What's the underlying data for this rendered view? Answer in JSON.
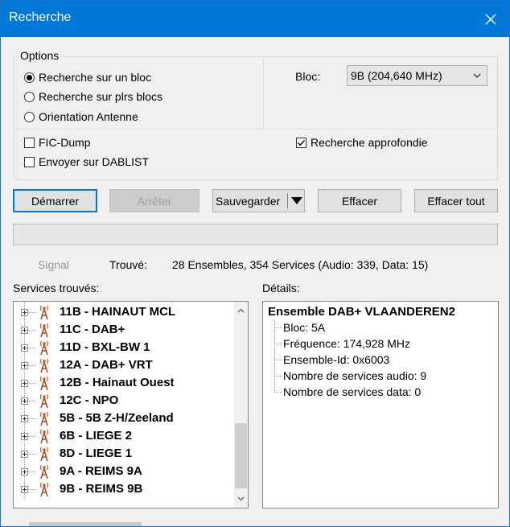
{
  "window": {
    "title": "Recherche"
  },
  "options": {
    "group_label": "Options",
    "search_modes": [
      {
        "label": "Recherche sur un bloc",
        "checked": true
      },
      {
        "label": "Recherche sur plrs blocs",
        "checked": false
      },
      {
        "label": "Orientation Antenne",
        "checked": false
      }
    ],
    "block_label": "Bloc:",
    "block_value": "9B (204,640 MHz)",
    "fic_dump": {
      "label": "FIC-Dump",
      "checked": false
    },
    "send_dablist": {
      "label": "Envoyer sur DABLIST",
      "checked": false
    },
    "deep_search": {
      "label": "Recherche approfondie",
      "checked": true
    }
  },
  "buttons": {
    "start": "Démarrer",
    "stop": "Arrêter",
    "save": "Sauvegarder",
    "clear": "Effacer",
    "clear_all": "Effacer tout"
  },
  "status": {
    "signal_label": "Signal",
    "found_label": "Trouvé:",
    "found_value": "28 Ensembles, 354 Services (Audio: 339, Data: 15)"
  },
  "services": {
    "label": "Services trouvés:",
    "items": [
      "11B - HAINAUT MCL",
      "11C - DAB+",
      "11D - BXL-BW 1",
      "12A - DAB+ VRT",
      "12B - Hainaut Ouest",
      "12C - NPO",
      "5B - 5B Z-H/Zeeland",
      "6B - LIEGE 2",
      "8D - LIEGE 1",
      "9A - REIMS 9A",
      "9B - REIMS 9B"
    ]
  },
  "details": {
    "label": "Détails:",
    "title": "Ensemble DAB+ VLAANDEREN2",
    "lines": [
      "Bloc: 5A",
      "Fréquence: 174,928 MHz",
      "Ensemble-Id: 0x6003",
      "Nombre de services audio: 9",
      "Nombre de services data: 0"
    ]
  },
  "colors": {
    "titlebar": "#0078d7",
    "antenna": "#d9541e",
    "focus": "#0078d7"
  }
}
